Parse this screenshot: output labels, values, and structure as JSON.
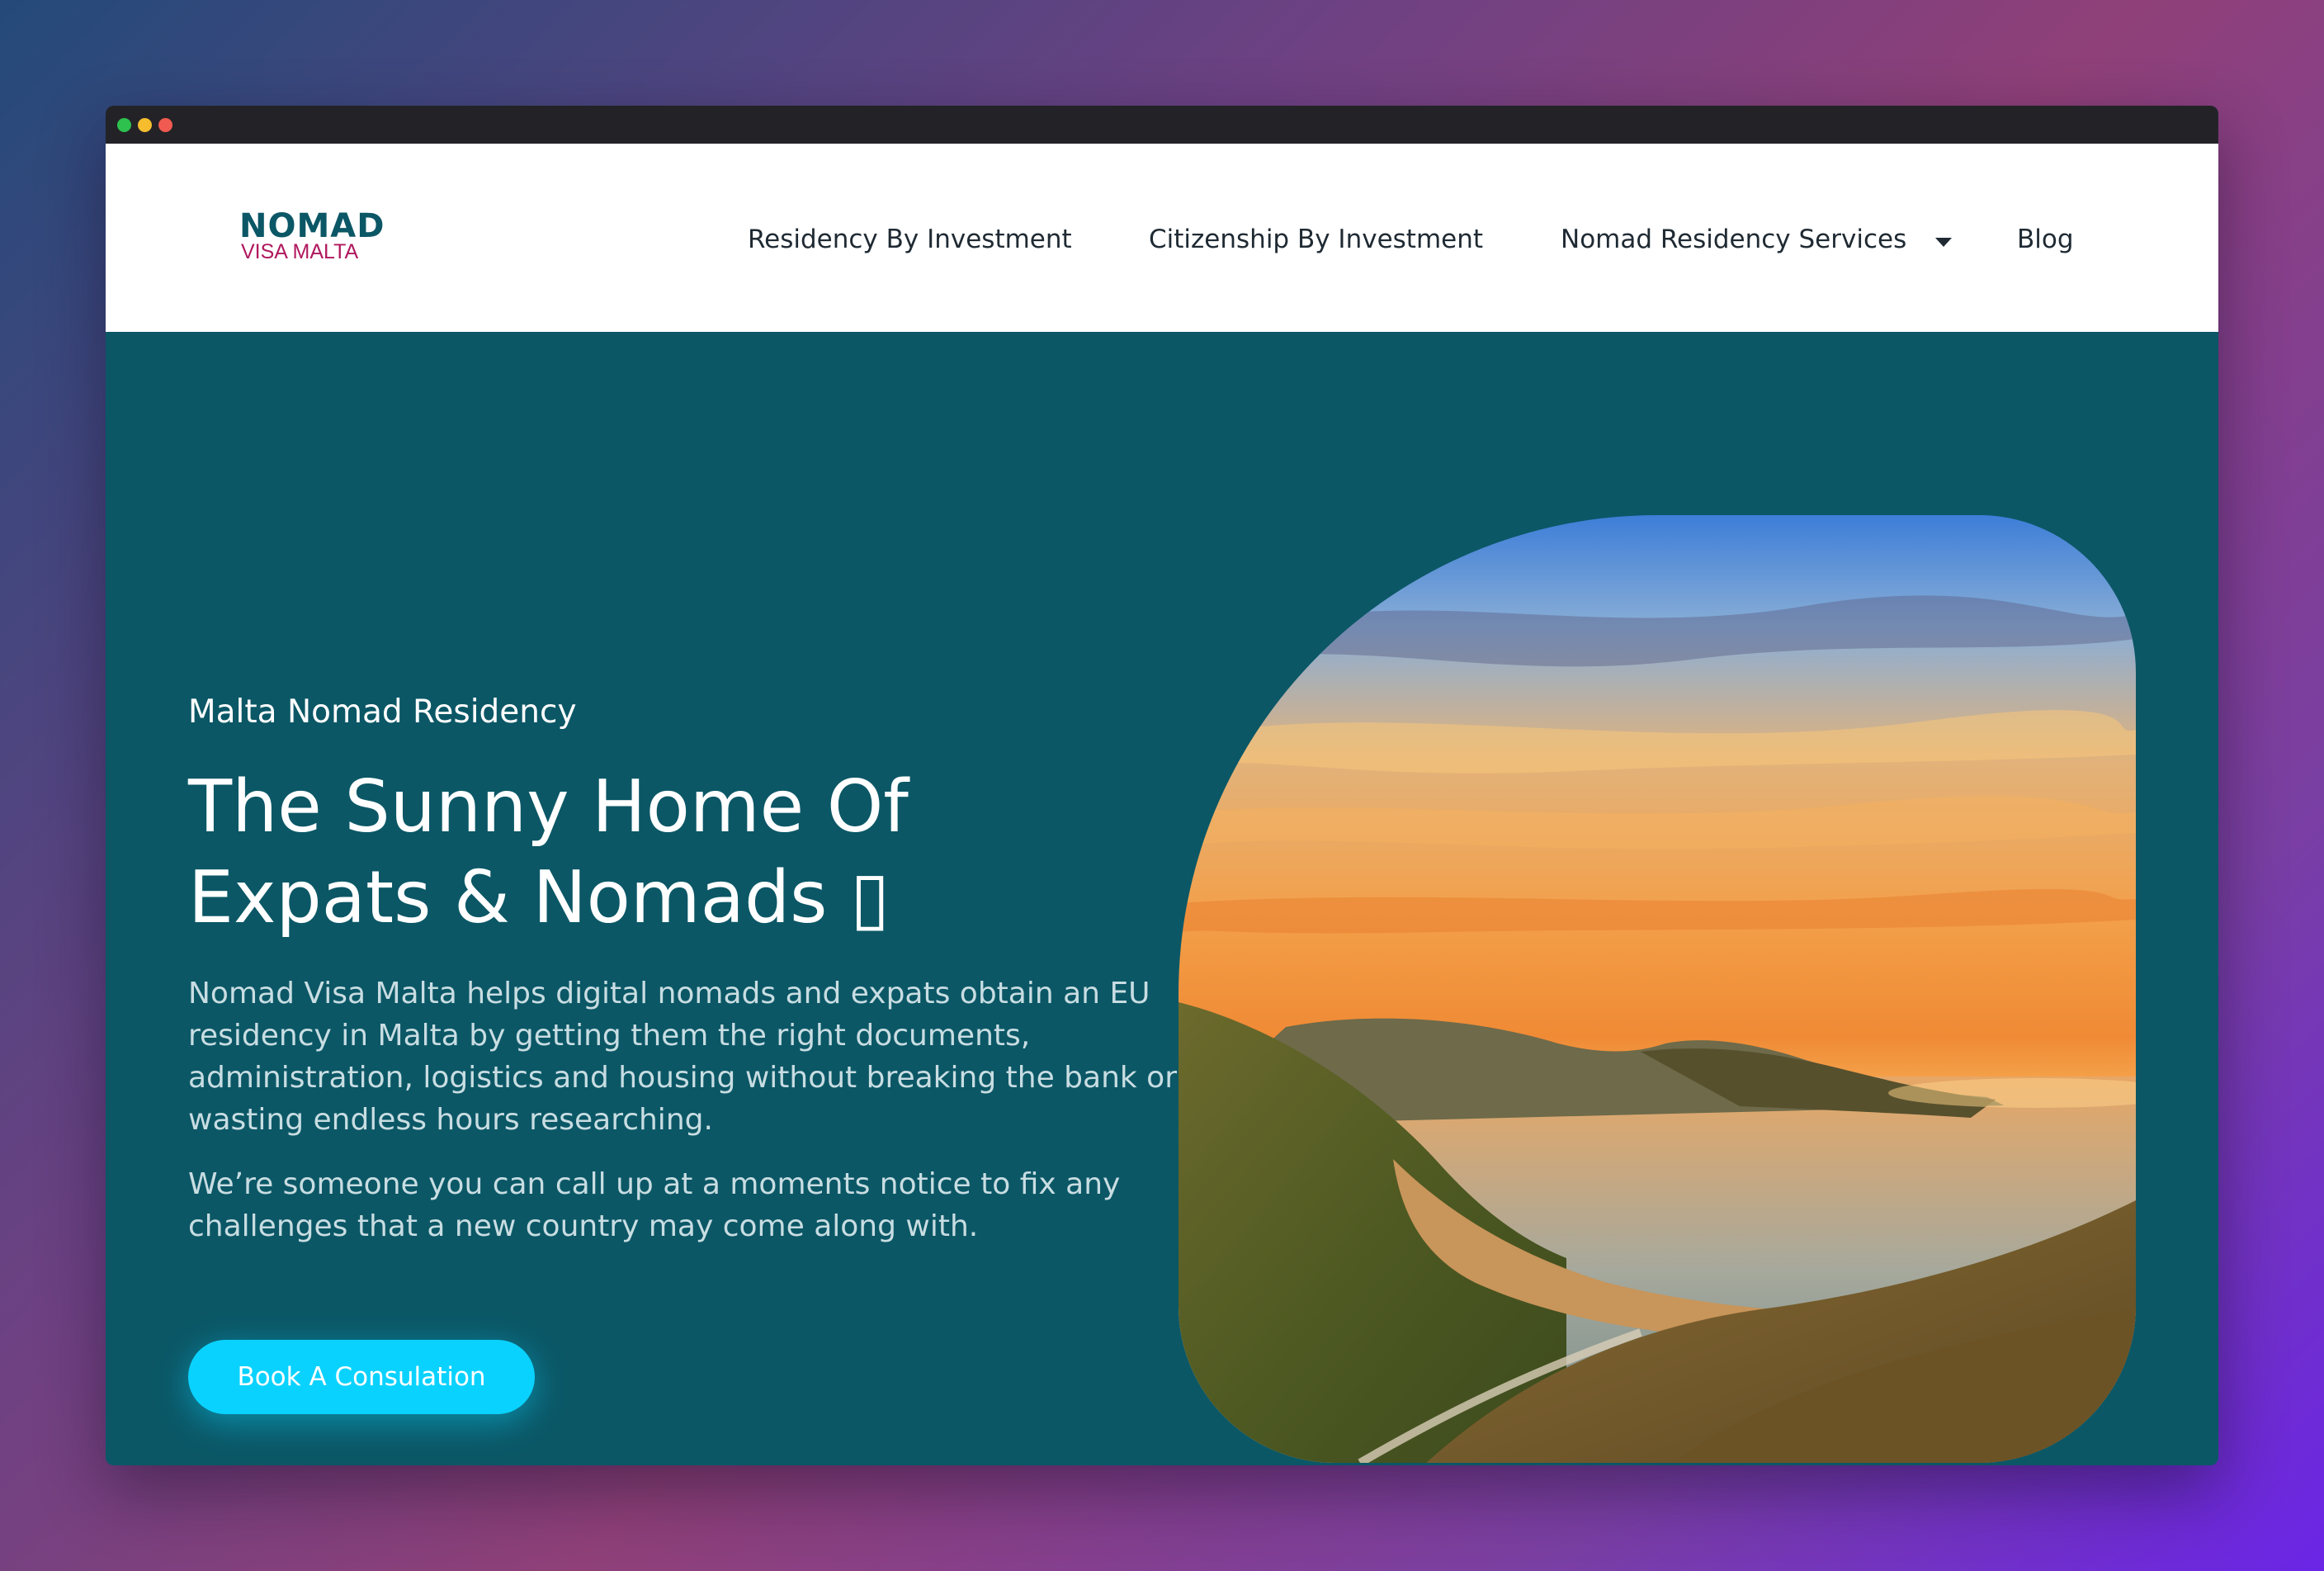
{
  "window": {
    "controls": [
      "green-dot",
      "yellow-dot",
      "red-dot"
    ]
  },
  "brand": {
    "logo_top": "NOMAD",
    "logo_bottom": "VISA MALTA",
    "primary_color": "#0b5766",
    "secondary_color": "#b0185e"
  },
  "nav": {
    "items": [
      {
        "label": "Residency By Investment"
      },
      {
        "label": "Citizenship By Investment"
      },
      {
        "label": "Nomad Residency Services",
        "has_dropdown": true
      },
      {
        "label": "Blog"
      }
    ]
  },
  "hero": {
    "eyebrow": "Malta Nomad Residency",
    "headline_line1": "The Sunny Home Of",
    "headline_line2": "Expats & Nomads ▯",
    "paragraph1": "Nomad Visa Malta helps digital nomads and expats obtain an EU residency in Malta by getting them the right documents, administration, logistics and housing without breaking the bank or wasting endless hours researching.",
    "paragraph2": "We’re someone you can call up at a moments notice to fix any challenges that a new country may come along with.",
    "cta_label": "Book A Consulation",
    "cta_color": "#0ad2ff",
    "background_color": "#0b5766"
  }
}
